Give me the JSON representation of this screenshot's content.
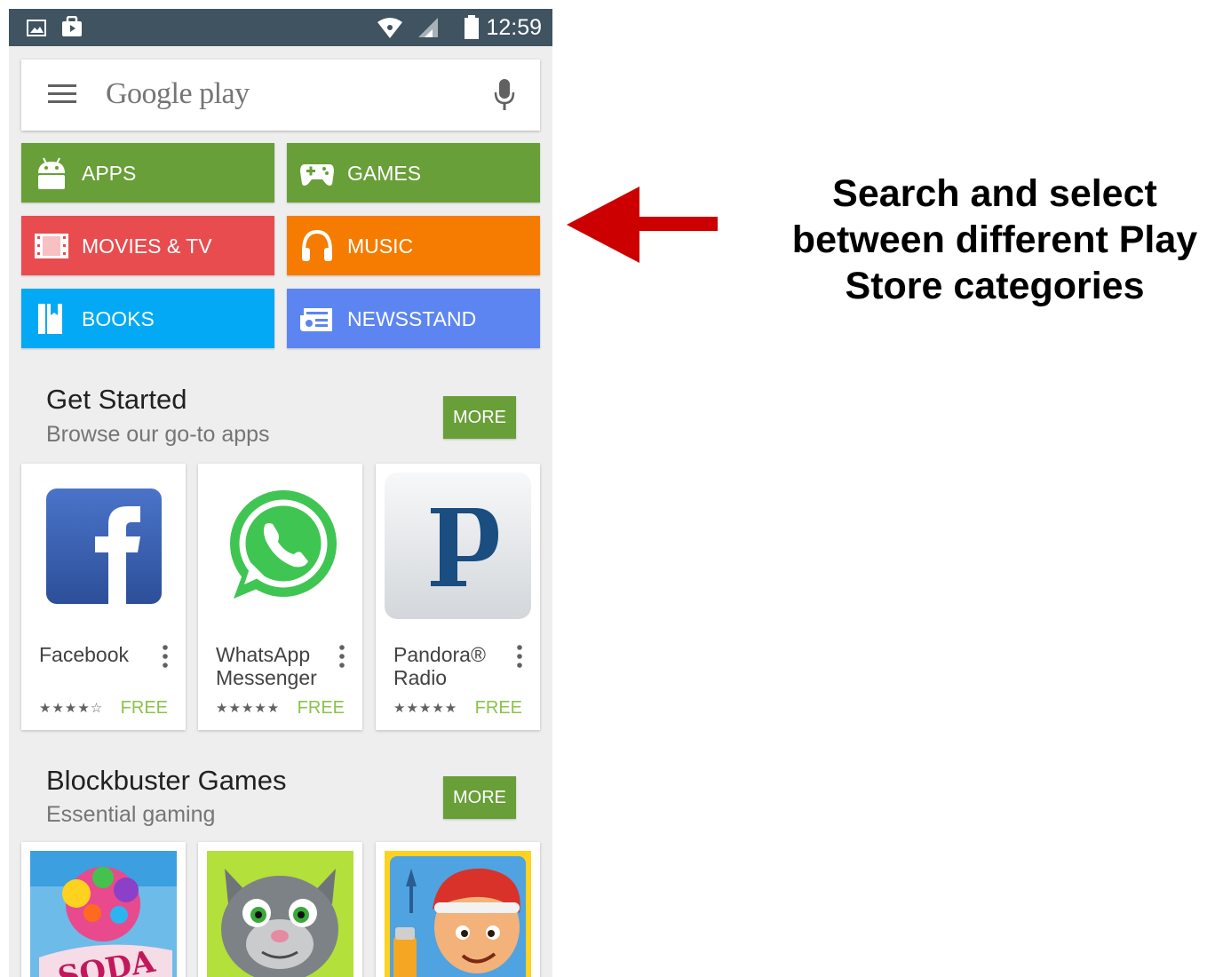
{
  "status_bar": {
    "time": "12:59"
  },
  "search": {
    "logo": "Google play",
    "menu_icon": "hamburger-menu-icon",
    "mic_icon": "microphone-icon"
  },
  "categories": [
    {
      "label": "APPS",
      "icon": "android-icon",
      "color": "#689f38"
    },
    {
      "label": "GAMES",
      "icon": "gamepad-icon",
      "color": "#689f38"
    },
    {
      "label": "MOVIES & TV",
      "icon": "film-icon",
      "color": "#e84c4f"
    },
    {
      "label": "MUSIC",
      "icon": "headphones-icon",
      "color": "#f57c00"
    },
    {
      "label": "BOOKS",
      "icon": "book-icon",
      "color": "#03a9f4"
    },
    {
      "label": "NEWSSTAND",
      "icon": "newspaper-icon",
      "color": "#5c85f2"
    }
  ],
  "sections": [
    {
      "title": "Get Started",
      "subtitle": "Browse our go-to apps",
      "more_label": "MORE",
      "apps": [
        {
          "name": "Facebook",
          "stars": "★★★★☆",
          "price": "FREE",
          "icon": "facebook-icon"
        },
        {
          "name": "WhatsApp Messenger",
          "stars": "★★★★★",
          "price": "FREE",
          "icon": "whatsapp-icon"
        },
        {
          "name": "Pandora® Radio",
          "stars": "★★★★★",
          "price": "FREE",
          "icon": "pandora-icon"
        }
      ]
    },
    {
      "title": "Blockbuster Games",
      "subtitle": "Essential gaming",
      "more_label": "MORE",
      "games": [
        {
          "icon": "candy-crush-soda-icon",
          "text": "SODA"
        },
        {
          "icon": "talking-tom-icon"
        },
        {
          "icon": "subway-surfers-icon"
        }
      ]
    }
  ],
  "annotation": {
    "text": "Search and select between different Play Store categories",
    "arrow_color": "#cc0000"
  }
}
